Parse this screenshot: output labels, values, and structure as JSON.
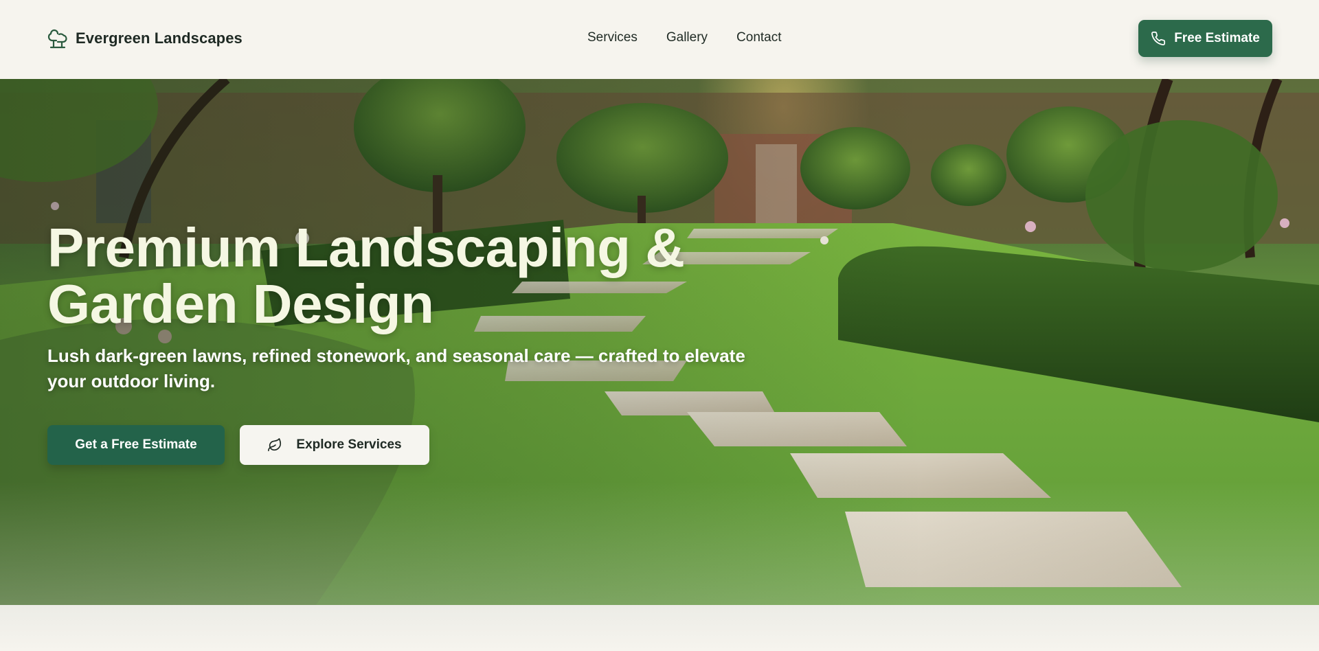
{
  "header": {
    "brand_name": "Evergreen Landscapes",
    "brand_icon": "tree-icon",
    "nav": [
      {
        "label": "Services"
      },
      {
        "label": "Gallery"
      },
      {
        "label": "Contact"
      }
    ],
    "cta_label": "Free Estimate",
    "cta_icon": "phone-icon"
  },
  "hero": {
    "title": "Premium Landscaping & Garden Design",
    "subtitle": "Lush dark-green lawns, refined stonework, and seasonal care — crafted to elevate your outdoor living.",
    "primary_button": "Get a Free Estimate",
    "secondary_button": "Explore Services",
    "secondary_icon": "leaf-icon"
  },
  "colors": {
    "accent": "#2c6a4b",
    "background": "#f6f4ee",
    "hero_title": "#f5f7e3"
  }
}
